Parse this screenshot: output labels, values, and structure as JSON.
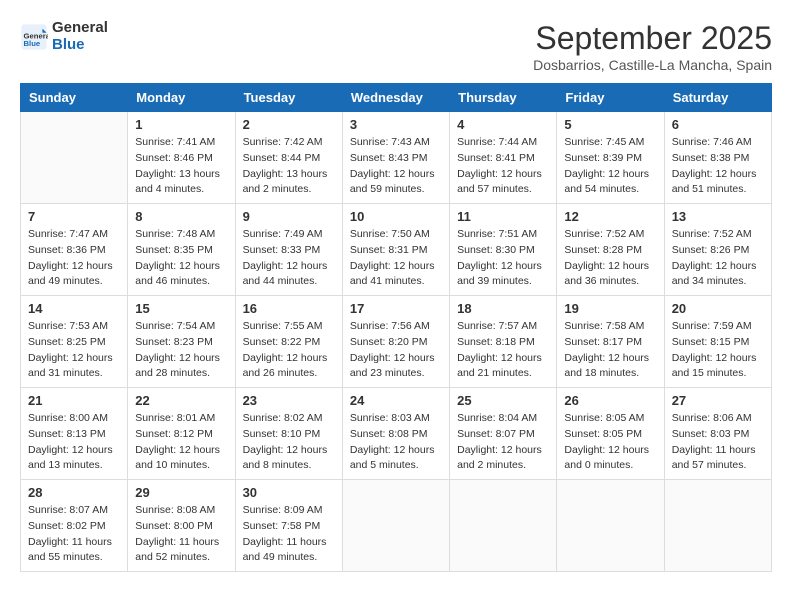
{
  "header": {
    "logo_line1": "General",
    "logo_line2": "Blue",
    "month": "September 2025",
    "location": "Dosbarrios, Castille-La Mancha, Spain"
  },
  "weekdays": [
    "Sunday",
    "Monday",
    "Tuesday",
    "Wednesday",
    "Thursday",
    "Friday",
    "Saturday"
  ],
  "weeks": [
    [
      null,
      {
        "day": 1,
        "sunrise": "7:41 AM",
        "sunset": "8:46 PM",
        "daylight": "13 hours and 4 minutes."
      },
      {
        "day": 2,
        "sunrise": "7:42 AM",
        "sunset": "8:44 PM",
        "daylight": "13 hours and 2 minutes."
      },
      {
        "day": 3,
        "sunrise": "7:43 AM",
        "sunset": "8:43 PM",
        "daylight": "12 hours and 59 minutes."
      },
      {
        "day": 4,
        "sunrise": "7:44 AM",
        "sunset": "8:41 PM",
        "daylight": "12 hours and 57 minutes."
      },
      {
        "day": 5,
        "sunrise": "7:45 AM",
        "sunset": "8:39 PM",
        "daylight": "12 hours and 54 minutes."
      },
      {
        "day": 6,
        "sunrise": "7:46 AM",
        "sunset": "8:38 PM",
        "daylight": "12 hours and 51 minutes."
      }
    ],
    [
      {
        "day": 7,
        "sunrise": "7:47 AM",
        "sunset": "8:36 PM",
        "daylight": "12 hours and 49 minutes."
      },
      {
        "day": 8,
        "sunrise": "7:48 AM",
        "sunset": "8:35 PM",
        "daylight": "12 hours and 46 minutes."
      },
      {
        "day": 9,
        "sunrise": "7:49 AM",
        "sunset": "8:33 PM",
        "daylight": "12 hours and 44 minutes."
      },
      {
        "day": 10,
        "sunrise": "7:50 AM",
        "sunset": "8:31 PM",
        "daylight": "12 hours and 41 minutes."
      },
      {
        "day": 11,
        "sunrise": "7:51 AM",
        "sunset": "8:30 PM",
        "daylight": "12 hours and 39 minutes."
      },
      {
        "day": 12,
        "sunrise": "7:52 AM",
        "sunset": "8:28 PM",
        "daylight": "12 hours and 36 minutes."
      },
      {
        "day": 13,
        "sunrise": "7:52 AM",
        "sunset": "8:26 PM",
        "daylight": "12 hours and 34 minutes."
      }
    ],
    [
      {
        "day": 14,
        "sunrise": "7:53 AM",
        "sunset": "8:25 PM",
        "daylight": "12 hours and 31 minutes."
      },
      {
        "day": 15,
        "sunrise": "7:54 AM",
        "sunset": "8:23 PM",
        "daylight": "12 hours and 28 minutes."
      },
      {
        "day": 16,
        "sunrise": "7:55 AM",
        "sunset": "8:22 PM",
        "daylight": "12 hours and 26 minutes."
      },
      {
        "day": 17,
        "sunrise": "7:56 AM",
        "sunset": "8:20 PM",
        "daylight": "12 hours and 23 minutes."
      },
      {
        "day": 18,
        "sunrise": "7:57 AM",
        "sunset": "8:18 PM",
        "daylight": "12 hours and 21 minutes."
      },
      {
        "day": 19,
        "sunrise": "7:58 AM",
        "sunset": "8:17 PM",
        "daylight": "12 hours and 18 minutes."
      },
      {
        "day": 20,
        "sunrise": "7:59 AM",
        "sunset": "8:15 PM",
        "daylight": "12 hours and 15 minutes."
      }
    ],
    [
      {
        "day": 21,
        "sunrise": "8:00 AM",
        "sunset": "8:13 PM",
        "daylight": "12 hours and 13 minutes."
      },
      {
        "day": 22,
        "sunrise": "8:01 AM",
        "sunset": "8:12 PM",
        "daylight": "12 hours and 10 minutes."
      },
      {
        "day": 23,
        "sunrise": "8:02 AM",
        "sunset": "8:10 PM",
        "daylight": "12 hours and 8 minutes."
      },
      {
        "day": 24,
        "sunrise": "8:03 AM",
        "sunset": "8:08 PM",
        "daylight": "12 hours and 5 minutes."
      },
      {
        "day": 25,
        "sunrise": "8:04 AM",
        "sunset": "8:07 PM",
        "daylight": "12 hours and 2 minutes."
      },
      {
        "day": 26,
        "sunrise": "8:05 AM",
        "sunset": "8:05 PM",
        "daylight": "12 hours and 0 minutes."
      },
      {
        "day": 27,
        "sunrise": "8:06 AM",
        "sunset": "8:03 PM",
        "daylight": "11 hours and 57 minutes."
      }
    ],
    [
      {
        "day": 28,
        "sunrise": "8:07 AM",
        "sunset": "8:02 PM",
        "daylight": "11 hours and 55 minutes."
      },
      {
        "day": 29,
        "sunrise": "8:08 AM",
        "sunset": "8:00 PM",
        "daylight": "11 hours and 52 minutes."
      },
      {
        "day": 30,
        "sunrise": "8:09 AM",
        "sunset": "7:58 PM",
        "daylight": "11 hours and 49 minutes."
      },
      null,
      null,
      null,
      null
    ]
  ]
}
